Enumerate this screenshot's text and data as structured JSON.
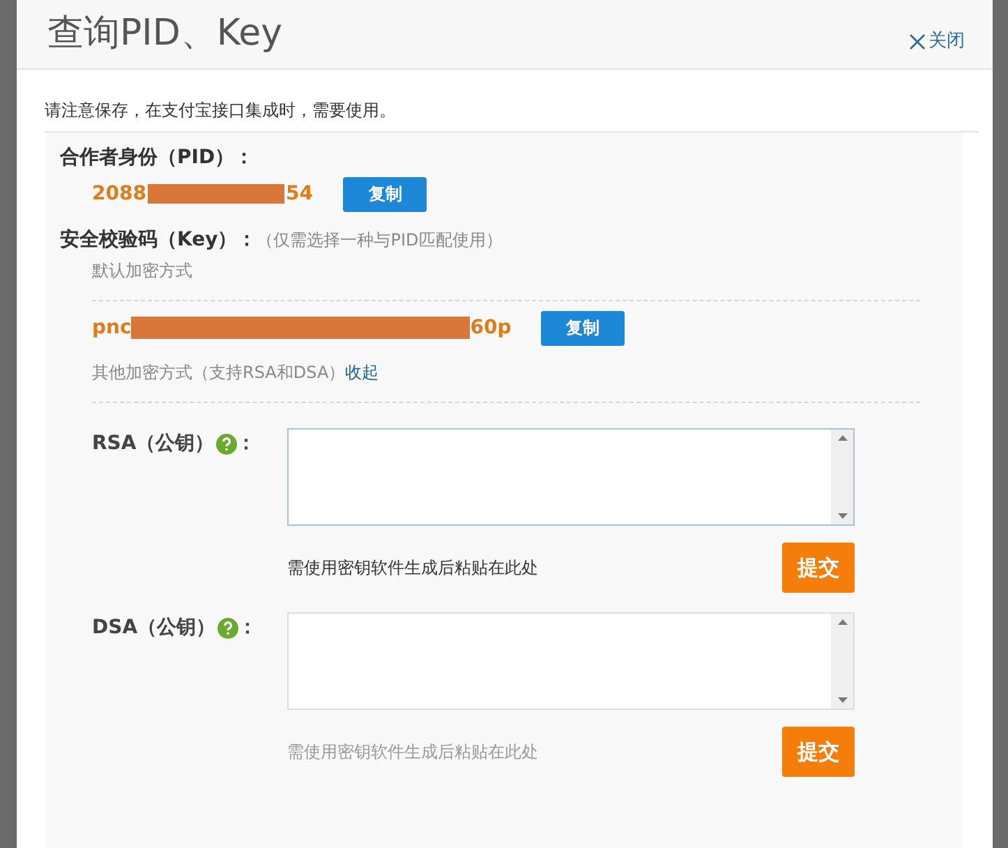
{
  "dialog": {
    "title": "查询PID、Key",
    "close": "关闭"
  },
  "notice": "请注意保存，在支付宝接口集成时，需要使用。",
  "pid": {
    "label": "合作者身份（PID）：",
    "value_start": "2088",
    "value_end": "54",
    "copy": "复制"
  },
  "key": {
    "label": "安全校验码（Key）：",
    "note": "（仅需选择一种与PID匹配使用）",
    "default_label": "默认加密方式",
    "value_start": "pnc",
    "value_end": "60p",
    "copy": "复制",
    "other_text": "其他加密方式（支持RSA和DSA）",
    "other_link": "收起"
  },
  "public_keys": [
    {
      "label": "RSA（公钥）",
      "colon": "：",
      "focused": true,
      "hint": "需使用密钥软件生成后粘贴在此处",
      "submit": "提交"
    },
    {
      "label": "DSA（公钥）",
      "colon": "：",
      "focused": false,
      "hint": "需使用密钥软件生成后粘贴在此处",
      "submit": "提交"
    }
  ]
}
